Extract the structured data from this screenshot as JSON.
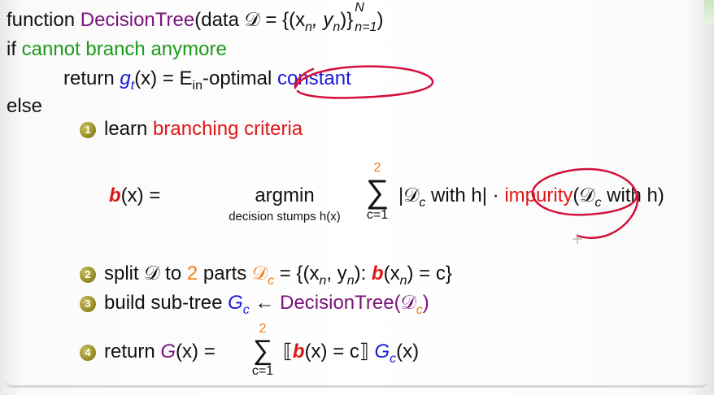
{
  "line1": {
    "func_kw": "function",
    "func_name": "DecisionTree",
    "args": "(data 𝒟 = {(x",
    "args_n": "n",
    "args_mid": ", y",
    "args_n2": "n",
    "args_end": ")}",
    "args_sup": "N",
    "args_sub": "n=1",
    "close": ")"
  },
  "line2": {
    "if_kw": "if",
    "cond": "cannot branch anymore"
  },
  "line3": {
    "ret": "return",
    "g": "g",
    "g_sub": "t",
    "rest": "(x) = E",
    "ein_sub": "in",
    "optimal": "-optimal",
    "const": "constant"
  },
  "line4": {
    "else": "else"
  },
  "step1": {
    "num": "1",
    "pre": "learn",
    "red": "branching criteria"
  },
  "formula1": {
    "lhs_b": "b",
    "lhs_rest": "(x) =",
    "argmin": "argmin",
    "argmin_sub": "decision stumps h(x)",
    "sum_top": "2",
    "sum": "∑",
    "sum_bottom": "c=1",
    "term1": "|𝒟",
    "term1_sub": "c",
    "term1_rest": " with h|",
    "dot": "·",
    "impurity": "impurity",
    "imp_arg": "(𝒟",
    "imp_sub": "c",
    "imp_rest": " with h)"
  },
  "step2": {
    "num": "2",
    "pre": "split 𝒟 to",
    "two": "2",
    "parts": "parts",
    "dc": "𝒟",
    "dc_sub": "c",
    "eq": " = {(x",
    "n1": "n",
    "mid": ", y",
    "n2": "n",
    "colon": "): ",
    "b": "b",
    "bx": "(x",
    "n3": "n",
    "end": ") = c}"
  },
  "step3": {
    "num": "3",
    "pre": "build sub-tree",
    "G": "G",
    "G_sub": "c",
    "arrow": " ← ",
    "dt": "DecisionTree",
    "arg": "(𝒟",
    "arg_sub": "c",
    "close": ")"
  },
  "step4": {
    "num": "4",
    "pre": "return",
    "G": "G",
    "rest": "(x) =",
    "sum_top": "2",
    "sum": "∑",
    "sum_bottom": "c=1",
    "open": "⟦",
    "b": "b",
    "bx": "(x) = c",
    "close": "⟧",
    "Gc": "G",
    "Gc_sub": "c",
    "Gc_rest": "(x)"
  },
  "colors": {
    "purple": "#7a137a",
    "green": "#1a9a1a",
    "blue": "#1a1ad6",
    "red": "#e01616",
    "orange": "#f07d14",
    "ink": "#d4103a"
  }
}
